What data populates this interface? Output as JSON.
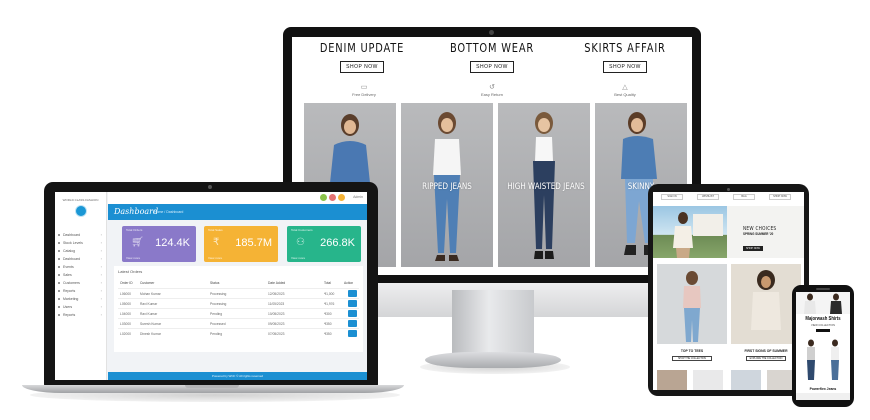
{
  "desktop": {
    "promos": [
      {
        "title": "DENIM UPDATE",
        "button": "SHOP NOW"
      },
      {
        "title": "BOTTOM WEAR",
        "button": "SHOP NOW"
      },
      {
        "title": "SKIRTS AFFAIR",
        "button": "SHOP NOW"
      }
    ],
    "features": [
      "Free Delivery",
      "Easy Return",
      "Best Quality"
    ],
    "tiles": [
      "",
      "RIPPED JEANS",
      "HIGH WAISTED JEANS",
      "SKINNY"
    ]
  },
  "laptop": {
    "brand": "WORLD CLASS FASHION",
    "nav": [
      "Dashboard",
      "Stock Levels",
      "Catalog",
      "Dashboard",
      "Events",
      "Sales",
      "Customers",
      "Reports",
      "Marketing",
      "Users",
      "Reports"
    ],
    "user": "Admin",
    "header": {
      "title": "Dashboard",
      "crumb": "Home / Dashboard"
    },
    "stats": [
      {
        "label": "Total Orders",
        "value": "124.4K",
        "foot": "View more",
        "icon": "cart-icon",
        "color": "#8a79c9"
      },
      {
        "label": "Total Sales",
        "value": "185.7M",
        "foot": "View more",
        "icon": "rupee-icon",
        "color": "#f5b335"
      },
      {
        "label": "Total Customers",
        "value": "266.8K",
        "foot": "View more",
        "icon": "customers-icon",
        "color": "#27b58b"
      }
    ],
    "orders": {
      "title": "Latest Orders",
      "headers": [
        "Order ID",
        "Customer",
        "Status",
        "Date Added",
        "Total",
        "Action"
      ],
      "rows": [
        [
          "L06000",
          "Mohan Kumar",
          "Processing",
          "12/05/2023",
          "₹1,000"
        ],
        [
          "L05000",
          "Ravi Kumar",
          "Processing",
          "11/05/2023",
          "₹1,976"
        ],
        [
          "L04000",
          "Ravi Kumar",
          "Pending",
          "10/05/2023",
          "₹300"
        ],
        [
          "L03000",
          "Suresh Kumar",
          "Processed",
          "09/05/2023",
          "₹350"
        ],
        [
          "L02000",
          "Dinesh Kumar",
          "Pending",
          "07/05/2023",
          "₹350"
        ]
      ]
    },
    "footer": "Powered by WCF © All rights reserved"
  },
  "tablet": {
    "nav": [
      "SIGN IN",
      "WISHLIST",
      "BAG",
      "SHOP NOW"
    ],
    "hero": {
      "heading": "NEW CHOICES",
      "sub": "SPRING SUMMER '20",
      "button": "SHOP NOW"
    },
    "cards": [
      {
        "label": "TOP TO TEES",
        "button": "SHOP THE COLLECTION"
      },
      {
        "label": "FIRST SIGNS OF SUMMER",
        "button": "EXPLORE THE COLLECTION"
      }
    ]
  },
  "phone": {
    "title": "Majorwash Shirts",
    "sub": "VIEW COLLECTION",
    "bottom": "Powerflex Jeans"
  },
  "colors": {
    "accent": "#1b8fd2",
    "purple": "#8a79c9",
    "orange": "#f5b335",
    "green": "#27b58b"
  }
}
